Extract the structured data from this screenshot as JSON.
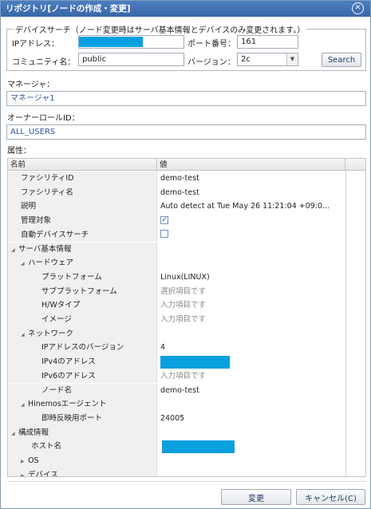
{
  "window": {
    "title": "リポジトリ[ノードの作成・変更]"
  },
  "device_search": {
    "legend": "デバイスサーチ（ノード変更時はサーバ基本情報とデバイスのみ変更されます。）",
    "ip_label": "IPアドレス：",
    "ip_value_redacted": true,
    "port_label": "ポート番号：",
    "port_value": "161",
    "community_label": "コミュニティ名：",
    "community_value": "public",
    "version_label": "バージョン：",
    "version_value": "2c",
    "search_button": "Search"
  },
  "manager": {
    "label": "マネージャ：",
    "value": "マネージャ1"
  },
  "owner_role": {
    "label": "オーナーロールID：",
    "value": "ALL_USERS"
  },
  "attributes": {
    "label": "属性：",
    "columns": [
      "名前",
      "値"
    ],
    "rows": [
      {
        "name": "ファシリティID",
        "value": "demo-test"
      },
      {
        "name": "ファシリティ名",
        "value": "demo-test"
      },
      {
        "name": "説明",
        "value": "Auto detect at Tue May 26 11:21:04 +09:0..."
      },
      {
        "name": "管理対象",
        "value": "checked"
      },
      {
        "name": "自動デバイスサーチ",
        "value": "unchecked"
      },
      {
        "name": "サーバ基本情報",
        "value": ""
      },
      {
        "name": "ハードウェア",
        "value": ""
      },
      {
        "name": "プラットフォーム",
        "value": "Linux(LINUX)"
      },
      {
        "name": "サブプラットフォーム",
        "value": "選択項目です"
      },
      {
        "name": "H/Wタイプ",
        "value": "入力項目です"
      },
      {
        "name": "イメージ",
        "value": "入力項目です"
      },
      {
        "name": "ネットワーク",
        "value": ""
      },
      {
        "name": "IPアドレスのバージョン",
        "value": "4"
      },
      {
        "name": "IPv4のアドレス",
        "value": ""
      },
      {
        "name": "IPv6のアドレス",
        "value": "入力項目です"
      },
      {
        "name": "ノード名",
        "value": "demo-test"
      },
      {
        "name": "Hinemosエージェント",
        "value": ""
      },
      {
        "name": "即時反映用ポート",
        "value": "24005"
      },
      {
        "name": "構成情報",
        "value": ""
      },
      {
        "name": "ホスト名",
        "value": ""
      },
      {
        "name": "OS",
        "value": ""
      },
      {
        "name": "デバイス",
        "value": ""
      }
    ]
  },
  "buttons": {
    "ok": "変更",
    "cancel": "キャンセル(C)"
  },
  "colors": {
    "titlebar": "#3f6fb1",
    "redaction": "#09a0e0",
    "name_column_bg": "#f0f0f0"
  },
  "icons": {
    "close": "close-circle-icon",
    "expanded": "tree-expanded-icon",
    "collapsed": "tree-collapsed-icon",
    "combo": "chevron-down-icon",
    "checkbox": "checkbox-icon"
  }
}
